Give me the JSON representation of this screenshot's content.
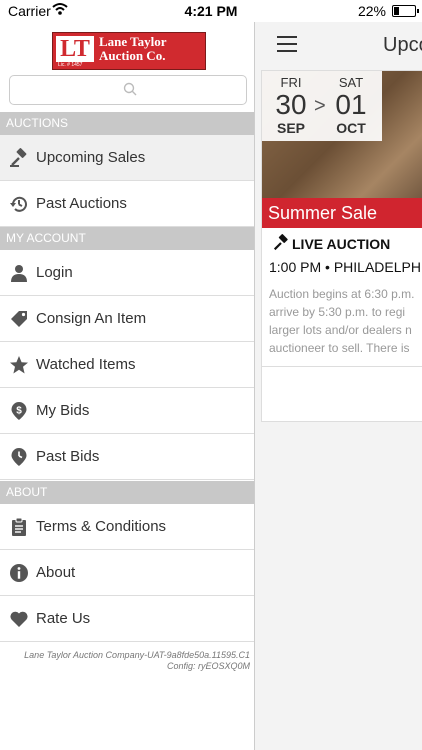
{
  "status": {
    "carrier": "Carrier",
    "time": "4:21 PM",
    "battery": "22%"
  },
  "drawer": {
    "logo": {
      "mark": "LT",
      "name_line1": "Lane Taylor",
      "name_line2": "Auction Co.",
      "license": "Lic. # 1457"
    },
    "search": {
      "placeholder": ""
    },
    "sections": {
      "auctions": "AUCTIONS",
      "account": "MY ACCOUNT",
      "about": "ABOUT"
    },
    "items": {
      "upcoming": "Upcoming Sales",
      "past_auctions": "Past Auctions",
      "login": "Login",
      "consign": "Consign An Item",
      "watched": "Watched Items",
      "my_bids": "My Bids",
      "past_bids": "Past Bids",
      "terms": "Terms & Conditions",
      "about": "About",
      "rate": "Rate Us"
    },
    "footer": {
      "line1": "Lane Taylor Auction Company-UAT-9a8fde50a.11595.C1",
      "line2": "Config: ryEOSXQ0M"
    }
  },
  "main": {
    "title": "Upco",
    "card": {
      "start": {
        "dow": "FRI",
        "day": "30",
        "mon": "SEP"
      },
      "end": {
        "dow": "SAT",
        "day": "01",
        "mon": "OCT"
      },
      "arrow": ">",
      "sale_name": "Summer Sale",
      "type": "LIVE AUCTION",
      "when": "1:00 PM • PHILADELPH",
      "desc1": "Auction begins at 6:30 p.m.",
      "desc2": "arrive by 5:30 p.m. to regi",
      "desc3": "larger lots and/or dealers n",
      "desc4": "auctioneer to sell. There is"
    }
  }
}
